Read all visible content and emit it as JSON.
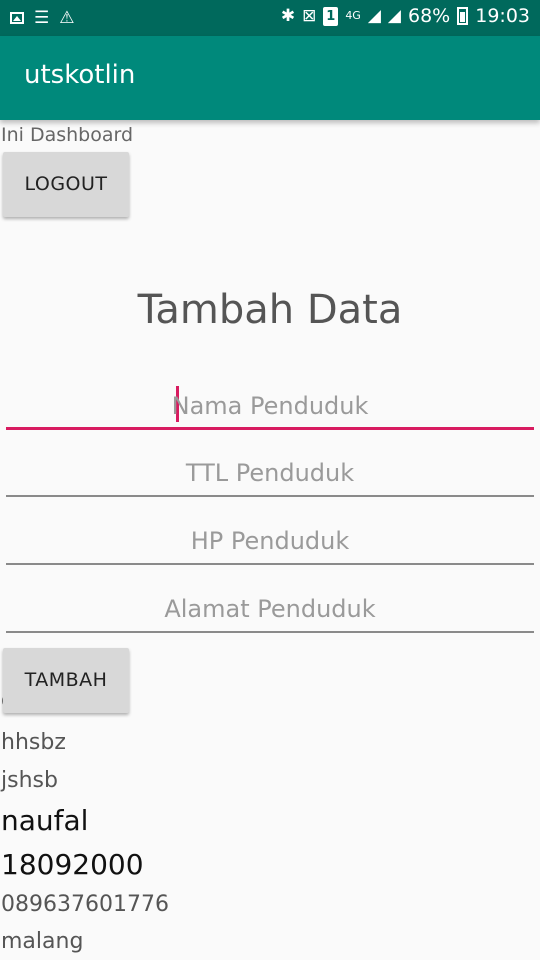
{
  "status_bar": {
    "battery_percent": "68%",
    "time": "19:03",
    "network": "4G",
    "sim_slot": "1",
    "icons_left": [
      "image-icon",
      "list-icon",
      "warning-icon"
    ],
    "icons_right": [
      "bluetooth-icon",
      "vibrate-icon",
      "sim-icon",
      "signal-icon",
      "battery-icon"
    ]
  },
  "app_bar": {
    "title": "utskotlin"
  },
  "dashboard": {
    "label": "Ini Dashboard",
    "logout_label": "LOGOUT"
  },
  "form": {
    "heading": "Tambah Data",
    "fields": [
      {
        "placeholder": "Nama Penduduk",
        "value": "",
        "focused": true
      },
      {
        "placeholder": "TTL Penduduk",
        "value": ""
      },
      {
        "placeholder": "HP Penduduk",
        "value": ""
      },
      {
        "placeholder": "Alamat Penduduk",
        "value": ""
      }
    ],
    "submit_label": "TAMBAH"
  },
  "data_items": [
    "g",
    "hhsbz",
    "jshsb",
    "naufal",
    "18092000",
    "089637601776",
    "malang"
  ],
  "colors": {
    "status_bar": "#00695c",
    "app_bar": "#00897b",
    "accent": "#d81b60",
    "background": "#fafafa",
    "button": "#d8d8d8"
  }
}
